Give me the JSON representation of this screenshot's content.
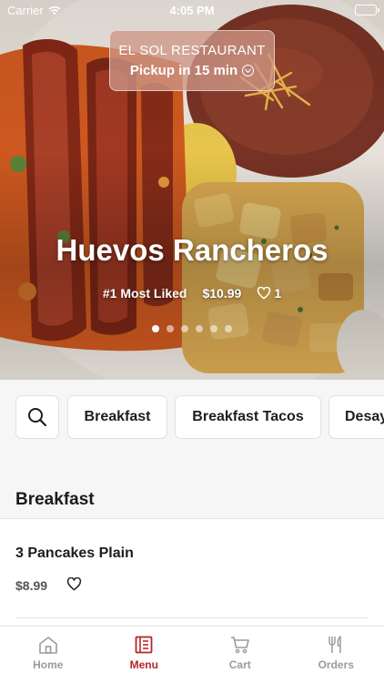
{
  "status_bar": {
    "carrier": "Carrier",
    "time": "4:05 PM"
  },
  "hero": {
    "restaurant_name": "EL SOL RESTAURANT",
    "pickup_text": "Pickup in 15 min",
    "dish_title": "Huevos Rancheros",
    "rank_label": "#1 Most Liked",
    "price": "$10.99",
    "likes": "1",
    "carousel_page_count": 6,
    "carousel_active_index": 0
  },
  "categories": {
    "search_icon": "search-icon",
    "chips": [
      "Breakfast",
      "Breakfast Tacos",
      "Desay"
    ]
  },
  "menu_section": {
    "title": "Breakfast",
    "items": [
      {
        "name": "3 Pancakes Plain",
        "price": "$8.99"
      }
    ]
  },
  "tab_bar": {
    "tabs": [
      {
        "label": "Home",
        "icon": "home-icon"
      },
      {
        "label": "Menu",
        "icon": "menu-icon"
      },
      {
        "label": "Cart",
        "icon": "cart-icon"
      },
      {
        "label": "Orders",
        "icon": "fork-knife-icon"
      }
    ],
    "active_tab": "Menu"
  },
  "colors": {
    "accent": "#b3262c",
    "inactive_tab": "#9b9b9b",
    "pill_bg": "#cd9687"
  }
}
